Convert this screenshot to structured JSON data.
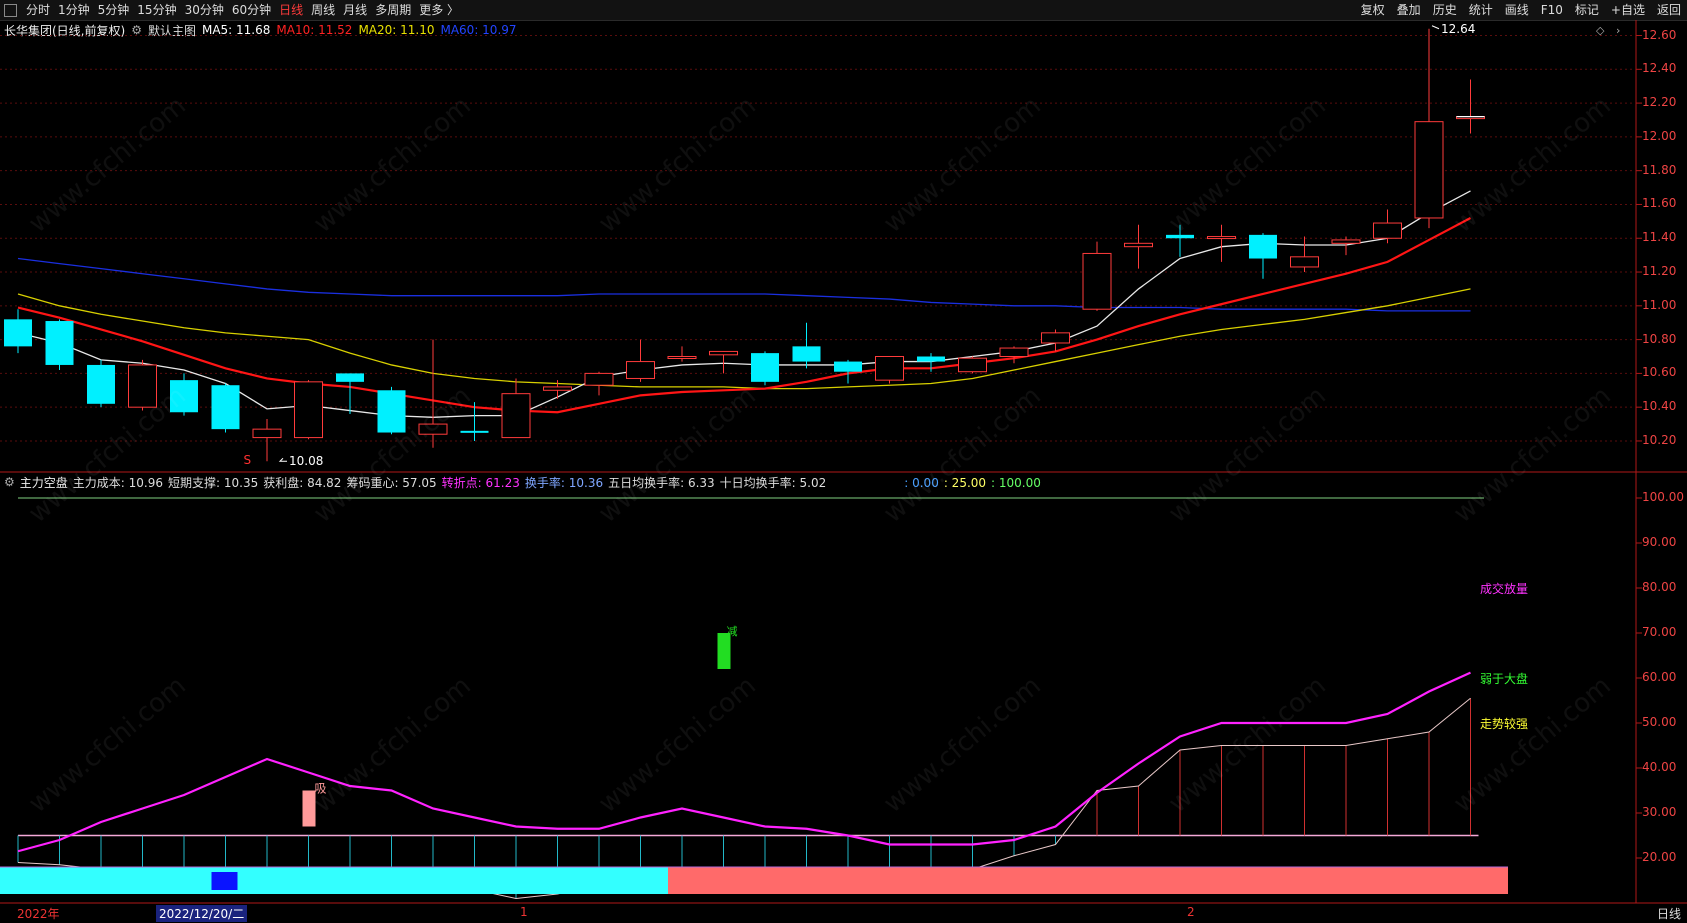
{
  "toolbar": {
    "tabs": [
      "分时",
      "1分钟",
      "5分钟",
      "15分钟",
      "30分钟",
      "60分钟",
      "日线",
      "周线",
      "月线",
      "多周期",
      "更多 〉"
    ],
    "active_tab": "日线",
    "tools": [
      "复权",
      "叠加",
      "历史",
      "统计",
      "画线",
      "F10",
      "标记",
      "+自选",
      "返回"
    ]
  },
  "main": {
    "stock": "长华集团(日线,前复权)",
    "chart_name": "默认主图",
    "ma": [
      {
        "label": "MA5: 11.68",
        "color": "#ffffff"
      },
      {
        "label": "MA10: 11.52",
        "color": "#ff2222"
      },
      {
        "label": "MA20: 11.10",
        "color": "#e8e000"
      },
      {
        "label": "MA60: 10.97",
        "color": "#2244ff"
      }
    ],
    "high_label": "12.64",
    "low_label": "10.08",
    "s_marker": "S"
  },
  "indicator": {
    "name": "主力空盘",
    "items": [
      {
        "label": "主力成本: 10.96",
        "color": "#dddddd"
      },
      {
        "label": "短期支撑: 10.35",
        "color": "#dddddd"
      },
      {
        "label": "获利盘: 84.82",
        "color": "#dddddd"
      },
      {
        "label": "筹码重心: 57.05",
        "color": "#dddddd"
      },
      {
        "label": "转折点: 61.23",
        "color": "#ff33ff"
      },
      {
        "label": "换手率: 10.36",
        "color": "#7fa6ff"
      },
      {
        "label": "五日均换手率: 6.33",
        "color": "#dddddd"
      },
      {
        "label": "十日均换手率: 5.02",
        "color": "#dddddd"
      }
    ],
    "extra": [
      {
        "label": ": 0.00",
        "color": "#4aa0ff"
      },
      {
        "label": ": 25.00",
        "color": "#ffff66"
      },
      {
        "label": ": 100.00",
        "color": "#66ff66"
      }
    ],
    "signals": {
      "buy": "吸",
      "sell": "减"
    },
    "right_labels": [
      {
        "text": "成交放量",
        "color": "#ff33ff"
      },
      {
        "text": "弱于大盘",
        "color": "#33ff33"
      },
      {
        "text": "走势较强",
        "color": "#ffff33"
      }
    ]
  },
  "axis": {
    "price_ticks": [
      "12.60",
      "12.40",
      "12.20",
      "12.00",
      "11.80",
      "11.60",
      "11.40",
      "11.20",
      "11.00",
      "10.80",
      "10.60",
      "10.40",
      "10.20"
    ],
    "ind_ticks": [
      "100.00",
      "90.00",
      "80.00",
      "70.00",
      "60.00",
      "50.00",
      "40.00",
      "30.00",
      "20.00"
    ]
  },
  "dates": {
    "year": "2022年",
    "selected": "2022/12/20/二",
    "m1": "1",
    "m2": "2"
  },
  "period_label": "日线",
  "watermark": "www.cfchi.com",
  "chart_data": {
    "type": "candlestick",
    "ylim": [
      10.04,
      12.68
    ],
    "candles": [
      {
        "o": 10.92,
        "h": 10.98,
        "l": 10.72,
        "c": 10.76
      },
      {
        "o": 10.91,
        "h": 10.92,
        "l": 10.62,
        "c": 10.65
      },
      {
        "o": 10.65,
        "h": 10.68,
        "l": 10.4,
        "c": 10.42
      },
      {
        "o": 10.4,
        "h": 10.68,
        "l": 10.38,
        "c": 10.65
      },
      {
        "o": 10.56,
        "h": 10.6,
        "l": 10.35,
        "c": 10.37
      },
      {
        "o": 10.53,
        "h": 10.54,
        "l": 10.25,
        "c": 10.27
      },
      {
        "o": 10.22,
        "h": 10.33,
        "l": 10.08,
        "c": 10.27
      },
      {
        "o": 10.22,
        "h": 10.56,
        "l": 10.21,
        "c": 10.55
      },
      {
        "o": 10.6,
        "h": 10.6,
        "l": 10.36,
        "c": 10.55
      },
      {
        "o": 10.5,
        "h": 10.52,
        "l": 10.24,
        "c": 10.25
      },
      {
        "o": 10.24,
        "h": 10.8,
        "l": 10.16,
        "c": 10.3
      },
      {
        "o": 10.26,
        "h": 10.43,
        "l": 10.2,
        "c": 10.25
      },
      {
        "o": 10.22,
        "h": 10.57,
        "l": 10.22,
        "c": 10.48
      },
      {
        "o": 10.5,
        "h": 10.56,
        "l": 10.45,
        "c": 10.52
      },
      {
        "o": 10.53,
        "h": 10.61,
        "l": 10.47,
        "c": 10.6
      },
      {
        "o": 10.57,
        "h": 10.8,
        "l": 10.55,
        "c": 10.67
      },
      {
        "o": 10.7,
        "h": 10.76,
        "l": 10.67,
        "c": 10.7
      },
      {
        "o": 10.71,
        "h": 10.73,
        "l": 10.6,
        "c": 10.73
      },
      {
        "o": 10.72,
        "h": 10.73,
        "l": 10.53,
        "c": 10.55
      },
      {
        "o": 10.76,
        "h": 10.9,
        "l": 10.63,
        "c": 10.67
      },
      {
        "o": 10.67,
        "h": 10.68,
        "l": 10.54,
        "c": 10.61
      },
      {
        "o": 10.56,
        "h": 10.7,
        "l": 10.54,
        "c": 10.7
      },
      {
        "o": 10.7,
        "h": 10.72,
        "l": 10.61,
        "c": 10.67
      },
      {
        "o": 10.61,
        "h": 10.7,
        "l": 10.6,
        "c": 10.69
      },
      {
        "o": 10.7,
        "h": 10.76,
        "l": 10.66,
        "c": 10.75
      },
      {
        "o": 10.78,
        "h": 10.86,
        "l": 10.73,
        "c": 10.84
      },
      {
        "o": 10.98,
        "h": 11.38,
        "l": 10.97,
        "c": 11.31
      },
      {
        "o": 11.35,
        "h": 11.48,
        "l": 11.22,
        "c": 11.37
      },
      {
        "o": 11.42,
        "h": 11.48,
        "l": 11.29,
        "c": 11.4
      },
      {
        "o": 11.4,
        "h": 11.48,
        "l": 11.26,
        "c": 11.41
      },
      {
        "o": 11.42,
        "h": 11.43,
        "l": 11.16,
        "c": 11.28
      },
      {
        "o": 11.23,
        "h": 11.41,
        "l": 11.2,
        "c": 11.29
      },
      {
        "o": 11.37,
        "h": 11.41,
        "l": 11.3,
        "c": 11.39
      },
      {
        "o": 11.4,
        "h": 11.57,
        "l": 11.37,
        "c": 11.49
      },
      {
        "o": 11.52,
        "h": 12.64,
        "l": 11.46,
        "c": 12.09
      },
      {
        "o": 12.12,
        "h": 12.34,
        "l": 12.02,
        "c": 12.12
      }
    ],
    "ma5": [
      10.84,
      10.78,
      10.68,
      10.66,
      10.62,
      10.54,
      10.39,
      10.41,
      10.38,
      10.35,
      10.34,
      10.35,
      10.35,
      10.46,
      10.58,
      10.62,
      10.65,
      10.66,
      10.65,
      10.65,
      10.65,
      10.67,
      10.67,
      10.7,
      10.73,
      10.78,
      10.88,
      11.1,
      11.28,
      11.35,
      11.37,
      11.36,
      11.36,
      11.4,
      11.55,
      11.68
    ],
    "ma10": [
      10.99,
      10.93,
      10.86,
      10.79,
      10.71,
      10.63,
      10.57,
      10.54,
      10.52,
      10.48,
      10.44,
      10.4,
      10.38,
      10.37,
      10.42,
      10.47,
      10.49,
      10.5,
      10.51,
      10.55,
      10.6,
      10.63,
      10.63,
      10.66,
      10.69,
      10.73,
      10.8,
      10.88,
      10.95,
      11.01,
      11.07,
      11.13,
      11.19,
      11.26,
      11.39,
      11.52
    ],
    "ma20": [
      11.07,
      11.0,
      10.95,
      10.91,
      10.87,
      10.84,
      10.82,
      10.8,
      10.72,
      10.65,
      10.6,
      10.57,
      10.55,
      10.54,
      10.53,
      10.52,
      10.52,
      10.52,
      10.51,
      10.51,
      10.52,
      10.53,
      10.54,
      10.57,
      10.62,
      10.67,
      10.72,
      10.77,
      10.82,
      10.86,
      10.89,
      10.92,
      10.96,
      11.0,
      11.05,
      11.1
    ],
    "ma60": [
      11.28,
      11.25,
      11.22,
      11.19,
      11.16,
      11.13,
      11.1,
      11.08,
      11.07,
      11.06,
      11.06,
      11.06,
      11.06,
      11.06,
      11.07,
      11.07,
      11.07,
      11.07,
      11.07,
      11.06,
      11.05,
      11.04,
      11.02,
      11.01,
      11.0,
      11.0,
      10.99,
      10.99,
      10.99,
      10.98,
      10.98,
      10.98,
      10.98,
      10.97,
      10.97,
      10.97
    ],
    "ind_ylim": [
      10,
      104
    ],
    "ind_base": 25,
    "ind_magenta": [
      21.5,
      24,
      28,
      31,
      34,
      38,
      42,
      39,
      36,
      35,
      31,
      29,
      27,
      26.5,
      26.5,
      29,
      31,
      29,
      27,
      26.5,
      25,
      23,
      23,
      23,
      24,
      27,
      34.5,
      41,
      47,
      50,
      50,
      50,
      50,
      52,
      57,
      61.2
    ],
    "ind_white": [
      19,
      18.5,
      17.5,
      17.5,
      17.5,
      17.5,
      17.5,
      18,
      17.5,
      17,
      16,
      13,
      11,
      12,
      14,
      15.5,
      15.5,
      17,
      17,
      17,
      17,
      17,
      17,
      17.5,
      20.5,
      23,
      35,
      36,
      44,
      45,
      45,
      45,
      45,
      46.5,
      48,
      55.5,
      57.1
    ],
    "buy_signal": {
      "index": 7,
      "top": 35,
      "bottom": 27
    },
    "sell_signal": {
      "index": 17,
      "top": 70,
      "bottom": 62
    },
    "bottom_band": {
      "cyan_end": 16,
      "blue_index": 5
    }
  }
}
